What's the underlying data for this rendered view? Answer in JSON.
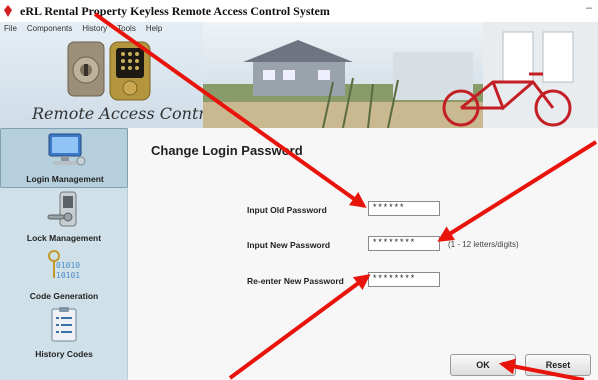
{
  "window": {
    "title": "eRL Rental Property Keyless Remote Access Control System",
    "minimize_glyph": "–"
  },
  "menu": [
    "File",
    "Components",
    "History",
    "Tools",
    "Help"
  ],
  "logo": {
    "text": "Remote Access Control"
  },
  "sidebar": {
    "items": [
      {
        "label": "Login Management",
        "icon": "computer-icon",
        "active": true
      },
      {
        "label": "Lock Management",
        "icon": "door-lock-icon",
        "active": false
      },
      {
        "label": "Code Generation",
        "icon": "keys-binary-icon",
        "active": false
      },
      {
        "label": "History Codes",
        "icon": "clipboard-list-icon",
        "active": false
      }
    ]
  },
  "main": {
    "title": "Change Login Password",
    "fields": [
      {
        "label": "Input Old Password",
        "value": "******"
      },
      {
        "label": "Input New Password",
        "value": "********",
        "hint": "(1 - 12 letters/digits)"
      },
      {
        "label": "Re-enter New Password",
        "value": "********"
      }
    ],
    "ok_label": "OK",
    "reset_label": "Reset"
  },
  "colors": {
    "annotation_arrow": "#e8140c",
    "sidebar_bg": "#cfe0e8",
    "content_bg": "#f7f7f7"
  }
}
